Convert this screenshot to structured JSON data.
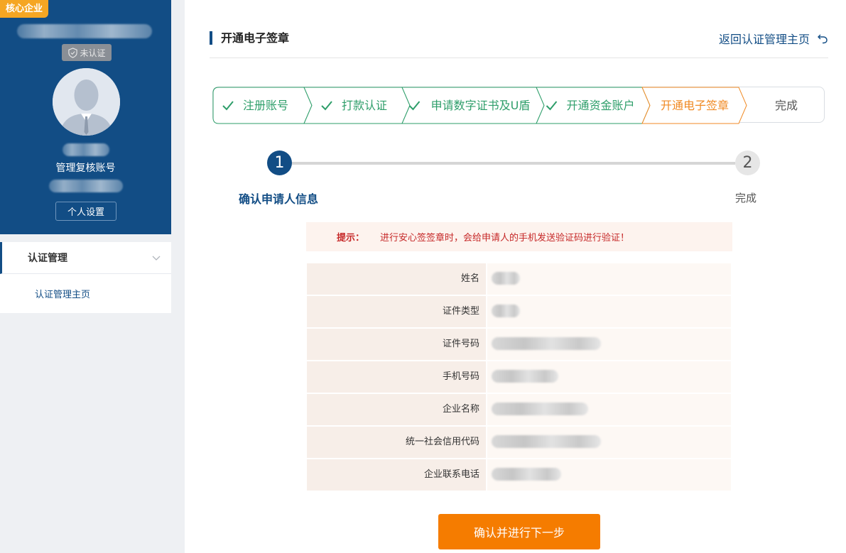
{
  "sidebar": {
    "corp_badge": "核心企业",
    "verify_status": "未认证",
    "role_name": "管理复核账号",
    "settings_label": "个人设置",
    "menu": {
      "group_label": "认证管理",
      "sub_item": "认证管理主页"
    }
  },
  "header": {
    "title": "开通电子签章",
    "back_link": "返回认证管理主页"
  },
  "steps": [
    {
      "label": "注册账号",
      "status": "done"
    },
    {
      "label": "打款认证",
      "status": "done"
    },
    {
      "label": "申请数字证书及U盾",
      "status": "done"
    },
    {
      "label": "开通资金账户",
      "status": "done"
    },
    {
      "label": "开通电子签章",
      "status": "current"
    },
    {
      "label": "完成",
      "status": "pending"
    }
  ],
  "progress": {
    "step1_number": "1",
    "step1_label": "确认申请人信息",
    "step2_number": "2",
    "step2_label": "完成"
  },
  "tip": {
    "label": "提示：",
    "text": "进行安心签签章时，会给申请人的手机发送验证码进行验证！"
  },
  "info_rows": [
    {
      "label": "姓名"
    },
    {
      "label": "证件类型"
    },
    {
      "label": "证件号码"
    },
    {
      "label": "手机号码"
    },
    {
      "label": "企业名称"
    },
    {
      "label": "统一社会信用代码"
    },
    {
      "label": "企业联系电话"
    }
  ],
  "confirm_button": "确认并进行下一步",
  "colors": {
    "primary": "#124d85",
    "done": "#2e9e6a",
    "current": "#f08a24",
    "button": "#f57c00"
  }
}
